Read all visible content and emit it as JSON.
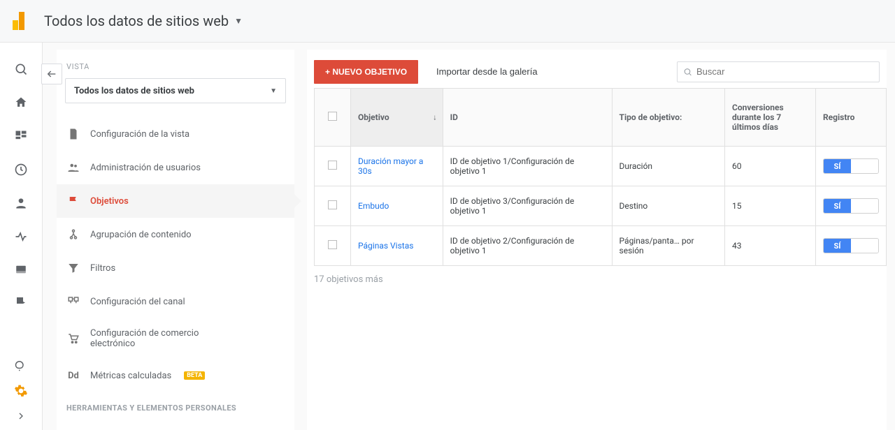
{
  "header": {
    "title": "Todos los datos de sitios web"
  },
  "leftPanel": {
    "vistaLabel": "VISTA",
    "viewSelector": "Todos los datos de sitios web",
    "menu": {
      "viewSettings": "Configuración de la vista",
      "userManagement": "Administración de usuarios",
      "goals": "Objetivos",
      "contentGrouping": "Agrupación de contenido",
      "filters": "Filtros",
      "channelSettings": "Configuración del canal",
      "ecommerceSettings": "Configuración de comercio electrónico",
      "calculatedMetrics": "Métricas calculadas",
      "betaBadge": "BETA"
    },
    "sectionHeader": "HERRAMIENTAS Y ELEMENTOS PERSONALES"
  },
  "main": {
    "newGoalBtn": "+ NUEVO OBJETIVO",
    "importGallery": "Importar desde la galería",
    "searchPlaceholder": "Buscar",
    "columns": {
      "objective": "Objetivo",
      "id": "ID",
      "goalType": "Tipo de objetivo:",
      "conversions": "Conversiones durante los 7 últimos días",
      "record": "Registro"
    },
    "rows": [
      {
        "name": "Duración mayor a 30s",
        "id": "ID de objetivo 1/Configuración de objetivo 1",
        "type": "Duración",
        "conv": "60",
        "toggle": "sí"
      },
      {
        "name": "Embudo",
        "id": "ID de objetivo 3/Configuración de objetivo 1",
        "type": "Destino",
        "conv": "15",
        "toggle": "sí"
      },
      {
        "name": "Páginas Vistas",
        "id": "ID de objetivo 2/Configuración de objetivo 1",
        "type": "Páginas/panta… por sesión",
        "conv": "43",
        "toggle": "sí"
      }
    ],
    "moreNote": "17 objetivos más"
  }
}
